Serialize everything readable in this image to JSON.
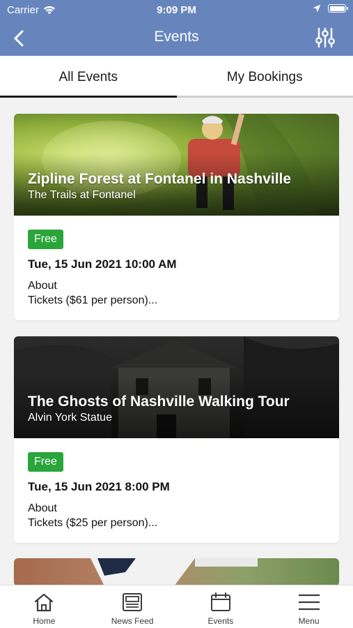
{
  "status_bar": {
    "carrier": "Carrier",
    "time": "9:09 PM"
  },
  "header": {
    "title": "Events"
  },
  "tabs": [
    {
      "label": "All Events",
      "active": true
    },
    {
      "label": "My Bookings",
      "active": false
    }
  ],
  "events": [
    {
      "title": "Zipline Forest at Fontanel in Nashville",
      "venue": "The Trails at Fontanel",
      "price_badge": "Free",
      "date": "Tue, 15 Jun 2021 10:00 AM",
      "about_label": "About",
      "description": "Tickets ($61 per person)..."
    },
    {
      "title": "The Ghosts of Nashville Walking Tour",
      "venue": "Alvin York Statue",
      "price_badge": "Free",
      "date": "Tue, 15 Jun 2021 8:00 PM",
      "about_label": "About",
      "description": "Tickets ($25 per person)..."
    }
  ],
  "bottom_nav": [
    {
      "label": "Home",
      "icon": "home-icon"
    },
    {
      "label": "News Feed",
      "icon": "news-feed-icon"
    },
    {
      "label": "Events",
      "icon": "calendar-icon"
    },
    {
      "label": "Menu",
      "icon": "menu-icon"
    }
  ],
  "colors": {
    "header_bg": "#6785bd",
    "badge_green": "#2aa53a"
  }
}
